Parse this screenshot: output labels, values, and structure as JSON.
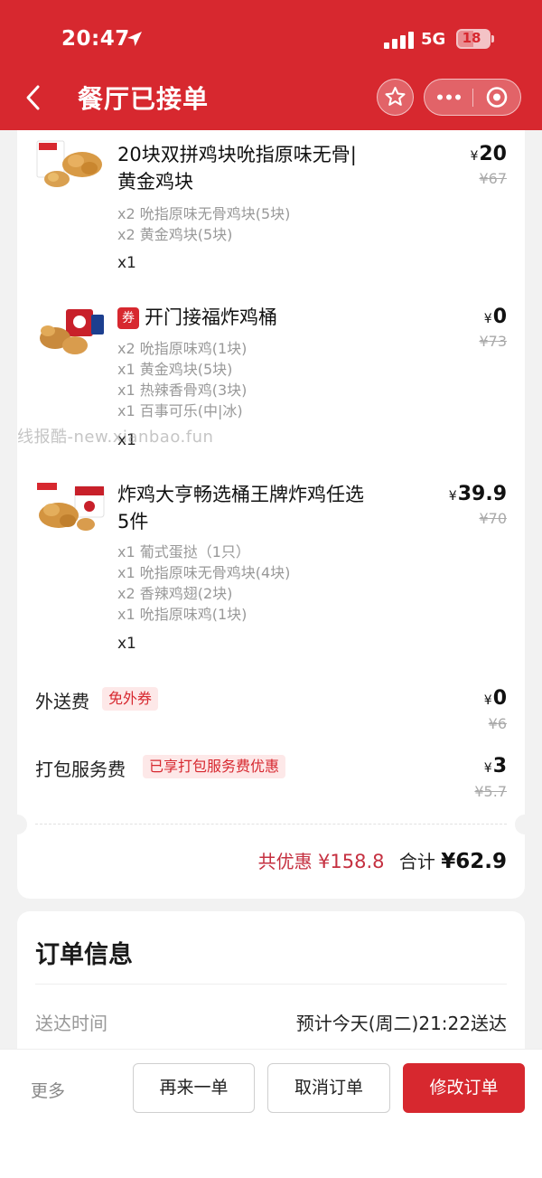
{
  "status_bar": {
    "time": "20:47",
    "network": "5G",
    "battery": "18"
  },
  "nav": {
    "title": "餐厅已接单"
  },
  "items": [
    {
      "name": "20块双拼鸡块吮指原味无骨|黄金鸡块",
      "name_line1": "20块双拼鸡块吮指原味无骨|",
      "name_line2": "黄金鸡块",
      "subs": [
        "x2 吮指原味无骨鸡块(5块)",
        "x2 黄金鸡块(5块)"
      ],
      "qty": "x1",
      "price": "20",
      "original": "¥67",
      "image": "nuggets-box-image"
    },
    {
      "badge": "券",
      "name": "开门接福炸鸡桶",
      "subs": [
        "x2 吮指原味鸡(1块)",
        "x1 黄金鸡块(5块)",
        "x1 热辣香骨鸡(3块)",
        "x1 百事可乐(中|冰)"
      ],
      "qty": "x1",
      "price": "0",
      "original": "¥73",
      "image": "chicken-bucket-image"
    },
    {
      "name": "炸鸡大亨畅选桶王牌炸鸡任选5件",
      "name_line1": "炸鸡大亨畅选桶王牌炸鸡任选",
      "name_line2": "5件",
      "subs": [
        "x1 葡式蛋挞（1只）",
        "x1 吮指原味无骨鸡块(4块)",
        "x2 香辣鸡翅(2块)",
        "x1 吮指原味鸡(1块)"
      ],
      "qty": "x1",
      "price": "39.9",
      "original": "¥70",
      "image": "fried-chicken-bucket-image"
    }
  ],
  "fees": {
    "delivery": {
      "label": "外送费",
      "tag": "免外券",
      "price": "0",
      "original": "¥6"
    },
    "packing": {
      "label": "打包服务费",
      "tag": "已享打包服务费优惠",
      "price": "3",
      "original": "¥5.7"
    }
  },
  "currency": "¥",
  "summary": {
    "discount_label": "共优惠",
    "discount": "¥158.8",
    "total_label": "合计",
    "total": "¥62.9"
  },
  "order_info": {
    "title": "订单信息",
    "delivery_time_label": "送达时间",
    "delivery_time_value": "预计今天(周二)21:22送达"
  },
  "bottom_bar": {
    "more": "更多",
    "reorder": "再来一单",
    "cancel": "取消订单",
    "modify": "修改订单"
  },
  "watermark": "线报酷-new.xianbao.fun",
  "colors": {
    "brand_red": "#d7282f",
    "discount_red": "#c53040",
    "muted_text": "#999999"
  }
}
